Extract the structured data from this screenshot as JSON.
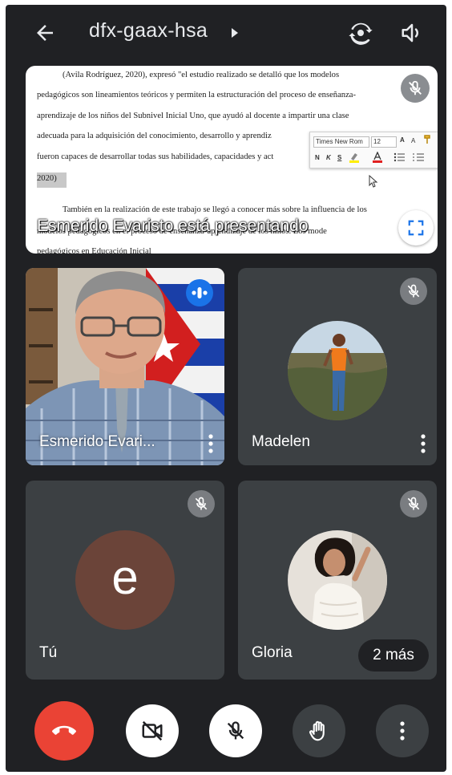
{
  "header": {
    "meeting_code": "dfx-gaax-hsa"
  },
  "presentation": {
    "presenting_label": "Esmerido Evaristo está presentando",
    "document_lines": [
      "(Avila Rodríguez, 2020), expresó \"el estudio realizado se detalló que los modelos",
      "pedagógicos son lineamientos teóricos y permiten la estructuración del proceso de enseñanza-",
      "aprendizaje de los niños del Subnivel Inicial Uno, que ayudó al docente a impartir una clase",
      "adecuada para la adquisición del conocimiento, desarrollo y aprendiz",
      "fueron capaces de desarrollar todas sus habilidades, capacidades y act",
      "2020)",
      "También en la realización de este trabajo se llegó a conocer más sobre la influencia de los",
      "modelos pedagógicos en el proceso de enseñanza-aprendizaje de los niños. Los mode",
      "pedagógicos en Educación Inicial"
    ],
    "toolbar": {
      "font_name": "Times New Rom",
      "font_size": "12",
      "grow_label": "A",
      "shrink_label": "A",
      "bold_label": "N",
      "italic_label": "K",
      "underline_label": "S"
    }
  },
  "participants": [
    {
      "name": "Esmerido Evari...",
      "state": "speaking",
      "video": true
    },
    {
      "name": "Madelen",
      "state": "muted"
    },
    {
      "name": "Tú",
      "state": "muted",
      "initial": "e",
      "avatar_color": "#6b4439"
    },
    {
      "name": "Gloria",
      "state": "muted"
    }
  ],
  "more_participants_label": "2 más",
  "controls": {
    "end_call_color": "#ea4335"
  }
}
